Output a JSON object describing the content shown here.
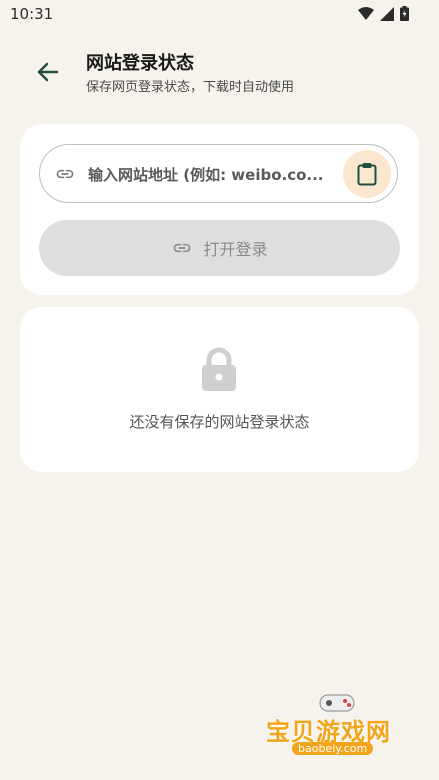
{
  "status_bar": {
    "time": "10:31"
  },
  "header": {
    "title": "网站登录状态",
    "subtitle": "保存网页登录状态，下载时自动使用"
  },
  "login_form": {
    "url_placeholder": "输入网站地址 (例如: weibo.co...",
    "open_login_label": "打开登录"
  },
  "empty_state": {
    "message": "还没有保存的网站登录状态"
  },
  "watermark": {
    "brand": "宝贝游戏网",
    "url": "baobeiy.com"
  },
  "colors": {
    "background": "#f6f3ec",
    "card": "#ffffff",
    "accent_dark_green": "#1f4f40",
    "paste_button_bg": "#fbe7cf",
    "disabled_button_bg": "#dedede"
  },
  "icons": {
    "back": "arrow-back-icon",
    "link": "link-icon",
    "paste": "clipboard-icon",
    "lock": "lock-icon"
  }
}
